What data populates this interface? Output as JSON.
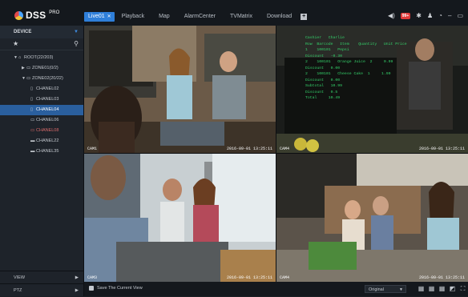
{
  "app": {
    "logo_text": "DSS",
    "logo_suffix": "PRO"
  },
  "tabs": [
    {
      "label": "Live01",
      "active": true
    },
    {
      "label": "Playback"
    },
    {
      "label": "Map"
    },
    {
      "label": "AlarmCenter"
    },
    {
      "label": "TVMatrix"
    },
    {
      "label": "Download"
    }
  ],
  "status": {
    "alarm_count": "99+"
  },
  "sidebar": {
    "device_header": "DEVICE",
    "tree": {
      "root": "ROOT(22/203)",
      "zone01": "ZONE01(0/2)",
      "zone02": "ZONE02(20/22)",
      "channels": [
        "CHANEL02",
        "CHANEL03",
        "CHANEL04",
        "CHANEL06",
        "CHANEL08",
        "CHANEL22",
        "CHANEL35"
      ]
    },
    "view_label": "VIEW",
    "ptz_label": "PTZ"
  },
  "cells": [
    {
      "cam": "CAM1",
      "time": "2016-09-01 13:25:11"
    },
    {
      "cam": "CAM4",
      "time": "2016-09-01 13:25:11"
    },
    {
      "cam": "CAM3",
      "time": "2016-09-01 13:25:11"
    },
    {
      "cam": "CAM4",
      "time": "2016-09-01 13:25:11"
    }
  ],
  "pos_receipt": {
    "l1": "Cashier   Charlie",
    "l2": "Row  Barcode   Item    Quantity   Unit Price",
    "l3": "1    100101   Pepsi",
    "l4": "Discount   -0.30",
    "l5": "2    100101   Orange Juice  2     0.99",
    "l6": "Discount   0.00",
    "l7": "2    100101   Cheese Cake  1     1.99",
    "l8": "Discount   0.00",
    "l9": "Subtotal   10.99",
    "l10": "Discount   0.5",
    "l11": "Total     10.49"
  },
  "bottom": {
    "save_label": "Save The Current View",
    "ratio": "Original"
  },
  "colors": {
    "accent": "#2f7fd9",
    "selected": "#2a5f9e",
    "pos_text": "#34d06a",
    "offline": "#d86a6a"
  }
}
